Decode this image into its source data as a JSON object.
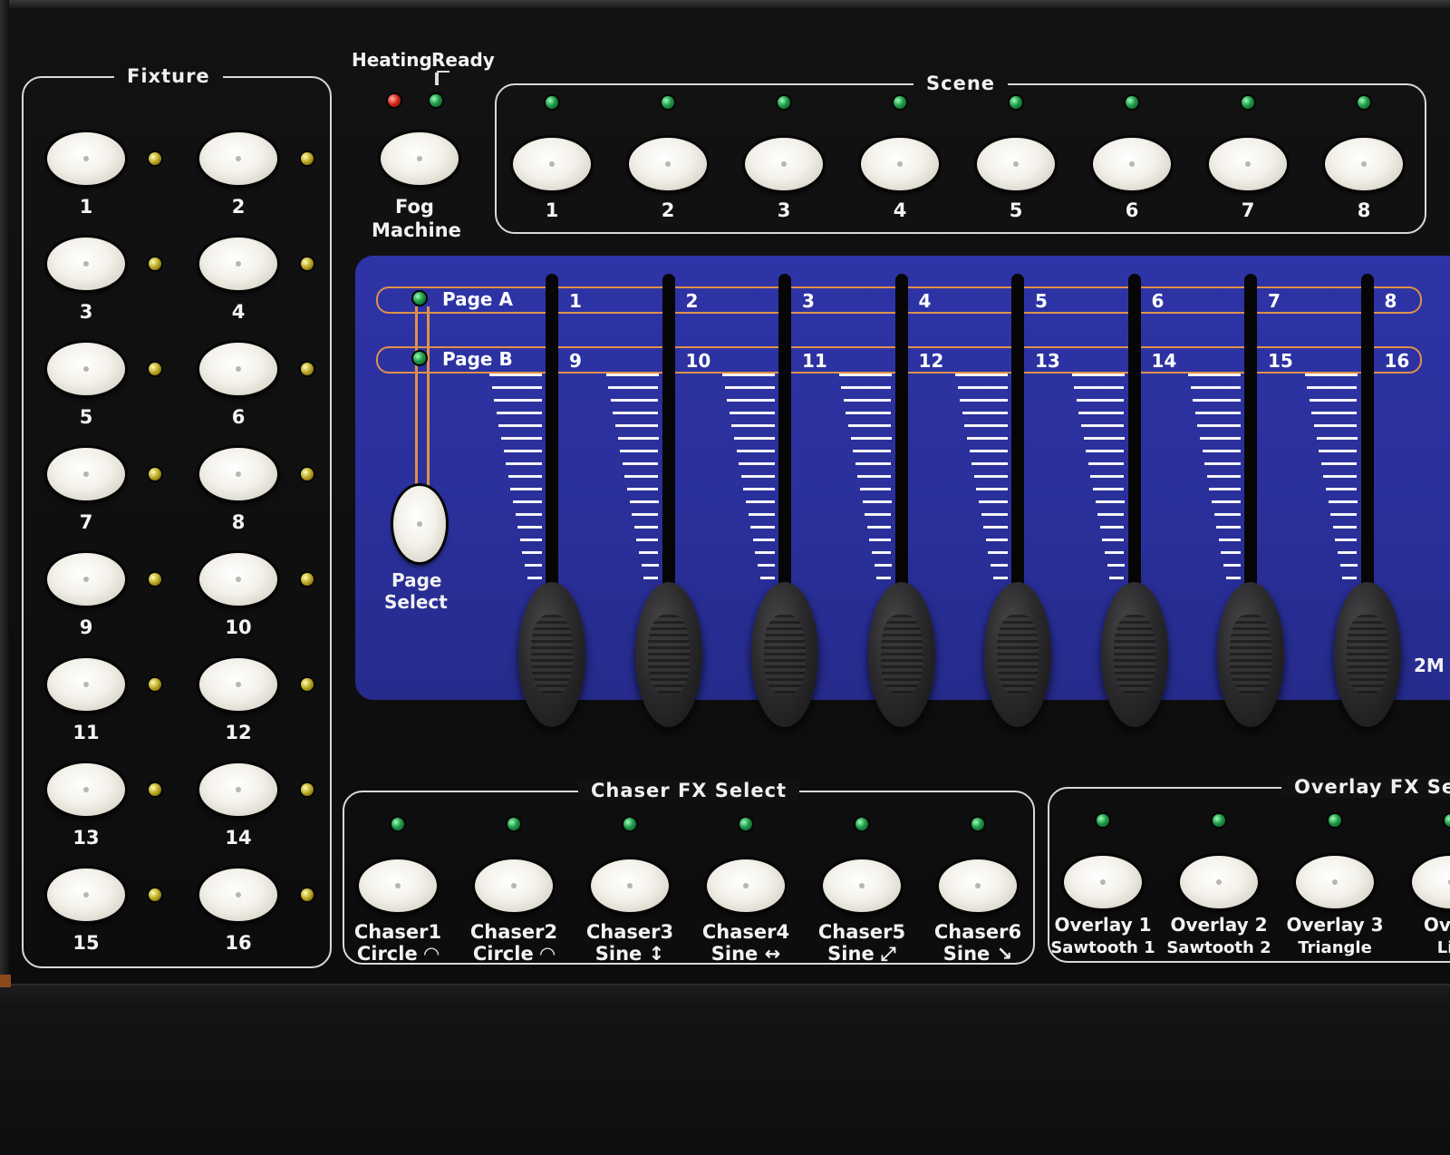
{
  "fixture": {
    "title": "Fixture",
    "buttons": [
      "1",
      "2",
      "3",
      "4",
      "5",
      "6",
      "7",
      "8",
      "9",
      "10",
      "11",
      "12",
      "13",
      "14",
      "15",
      "16"
    ]
  },
  "fog": {
    "heating_label": "Heating",
    "ready_label": "Ready",
    "button_label_line1": "Fog",
    "button_label_line2": "Machine"
  },
  "scene": {
    "title": "Scene",
    "buttons": [
      "1",
      "2",
      "3",
      "4",
      "5",
      "6",
      "7",
      "8"
    ]
  },
  "faders": {
    "page_a_label": "Page A",
    "page_b_label": "Page B",
    "page_select_line1": "Page",
    "page_select_line2": "Select",
    "page_a_channels": [
      "1",
      "2",
      "3",
      "4",
      "5",
      "6",
      "7",
      "8"
    ],
    "page_b_channels": [
      "9",
      "10",
      "11",
      "12",
      "13",
      "14",
      "15",
      "16"
    ],
    "model_fragment": "2M",
    "colors": {
      "panel": "#2c32a0",
      "page_outline": "#e0904a"
    }
  },
  "chaser": {
    "title": "Chaser FX Select",
    "buttons": [
      {
        "line1": "Chaser1",
        "line2": "Circle ◠"
      },
      {
        "line1": "Chaser2",
        "line2": "Circle ◠"
      },
      {
        "line1": "Chaser3",
        "line2": "Sine ↕"
      },
      {
        "line1": "Chaser4",
        "line2": "Sine ↔"
      },
      {
        "line1": "Chaser5",
        "line2": "Sine ⤢"
      },
      {
        "line1": "Chaser6",
        "line2": "Sine ↘"
      }
    ]
  },
  "overlay": {
    "title": "Overlay FX Sel",
    "buttons": [
      {
        "line1": "Overlay 1",
        "line2": "Sawtooth 1"
      },
      {
        "line1": "Overlay 2",
        "line2": "Sawtooth 2"
      },
      {
        "line1": "Overlay 3",
        "line2": "Triangle"
      },
      {
        "line1": "Overl",
        "line2": "Lin"
      }
    ]
  }
}
